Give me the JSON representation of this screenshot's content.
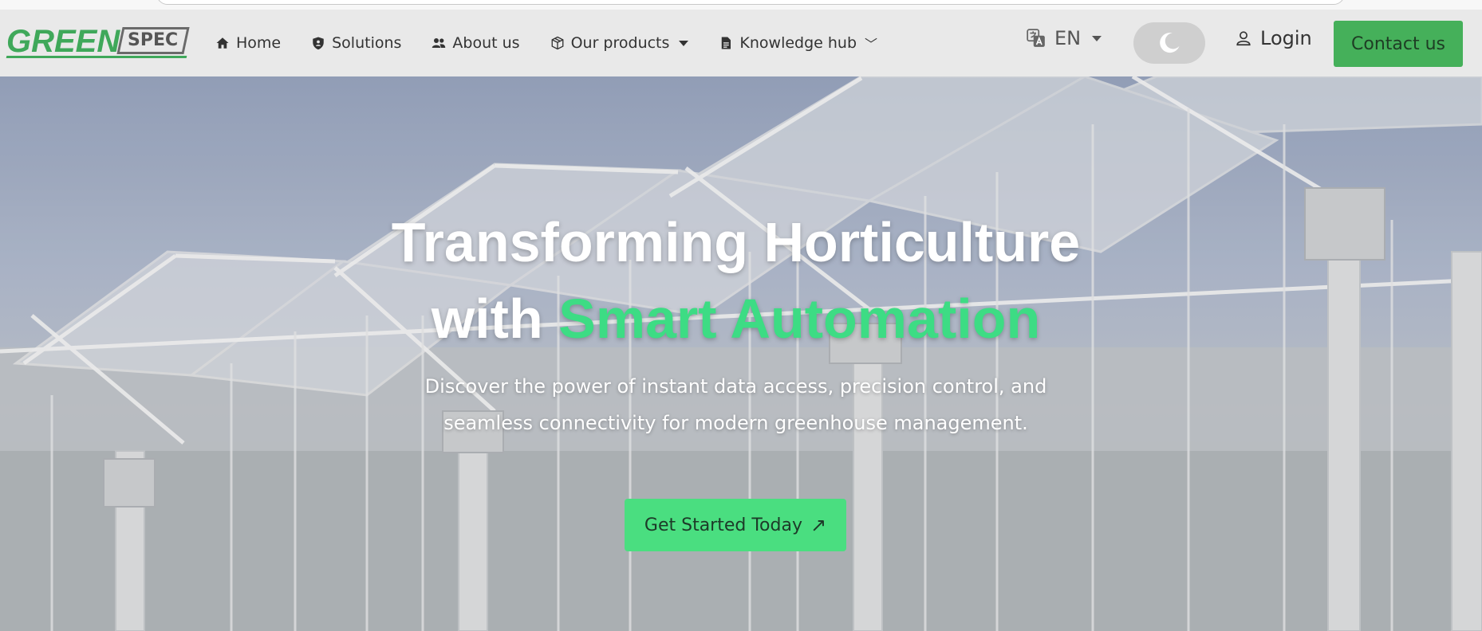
{
  "brand": {
    "logo_primary": "GREEN",
    "logo_secondary": "SPEC",
    "color": "#3fa85a"
  },
  "nav": {
    "items": [
      {
        "label": "Home",
        "icon": "home-icon"
      },
      {
        "label": "Solutions",
        "icon": "shield-icon"
      },
      {
        "label": "About us",
        "icon": "users-icon"
      },
      {
        "label": "Our products",
        "icon": "box-icon",
        "dropdown": true
      },
      {
        "label": "Knowledge hub",
        "icon": "document-icon",
        "chevron": "﹀"
      }
    ],
    "language": {
      "label": "EN",
      "icon": "translate-icon"
    },
    "theme_toggle": {
      "icon": "moon-icon"
    },
    "login": {
      "label": "Login",
      "icon": "user-icon"
    },
    "contact": {
      "label": "Contact us",
      "color": "#45b05a"
    }
  },
  "hero": {
    "title_line1": "Transforming Horticulture",
    "title_line2_prefix": "with ",
    "title_line2_accent": "Smart Automation",
    "accent_color": "#3ddc84",
    "subtitle": "Discover the power of instant data access, precision control, and seamless connectivity for modern greenhouse management.",
    "cta": {
      "label": "Get Started Today",
      "icon": "arrow-up-right-icon",
      "arrow": "↗"
    }
  }
}
